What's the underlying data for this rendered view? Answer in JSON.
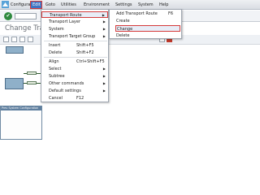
{
  "menubar": {
    "items": [
      {
        "label": "Configuration"
      },
      {
        "label": "Edit"
      },
      {
        "label": "Goto"
      },
      {
        "label": "Utilities"
      },
      {
        "label": "Environment"
      },
      {
        "label": "Settings"
      },
      {
        "label": "System"
      },
      {
        "label": "Help"
      }
    ]
  },
  "toolbar": {
    "ok_icon": "check-icon",
    "ok_symbol": "✔"
  },
  "page": {
    "title": "Change Transport"
  },
  "canvas": {
    "bottom_header": "Prev System Configuration"
  },
  "edit_menu": {
    "items": [
      {
        "label": "Transport Route",
        "shortcut": "",
        "arrow": "▶"
      },
      {
        "label": "Transport Layer",
        "shortcut": "",
        "arrow": "▶"
      },
      {
        "label": "System",
        "shortcut": "",
        "arrow": "▶"
      },
      {
        "label": "Transport Target Group",
        "shortcut": "",
        "arrow": "▶"
      },
      {
        "label": "Insert",
        "shortcut": "Shift+F5",
        "arrow": ""
      },
      {
        "label": "Delete",
        "shortcut": "Shift+F2",
        "arrow": ""
      },
      {
        "label": "Align",
        "shortcut": "Ctrl+Shift+F5",
        "arrow": ""
      },
      {
        "label": "Select",
        "shortcut": "",
        "arrow": "▶"
      },
      {
        "label": "Subtree",
        "shortcut": "",
        "arrow": "▶"
      },
      {
        "label": "Other commands",
        "shortcut": "",
        "arrow": "▶"
      },
      {
        "label": "Default settings",
        "shortcut": "",
        "arrow": "▶"
      },
      {
        "label": "Cancel",
        "shortcut": "F12",
        "arrow": ""
      }
    ]
  },
  "transport_route_submenu": {
    "items": [
      {
        "label": "Add Transport Route",
        "shortcut": "F6"
      },
      {
        "label": "Create",
        "shortcut": ""
      },
      {
        "label": "Change",
        "shortcut": ""
      },
      {
        "label": "Delete",
        "shortcut": ""
      }
    ]
  }
}
